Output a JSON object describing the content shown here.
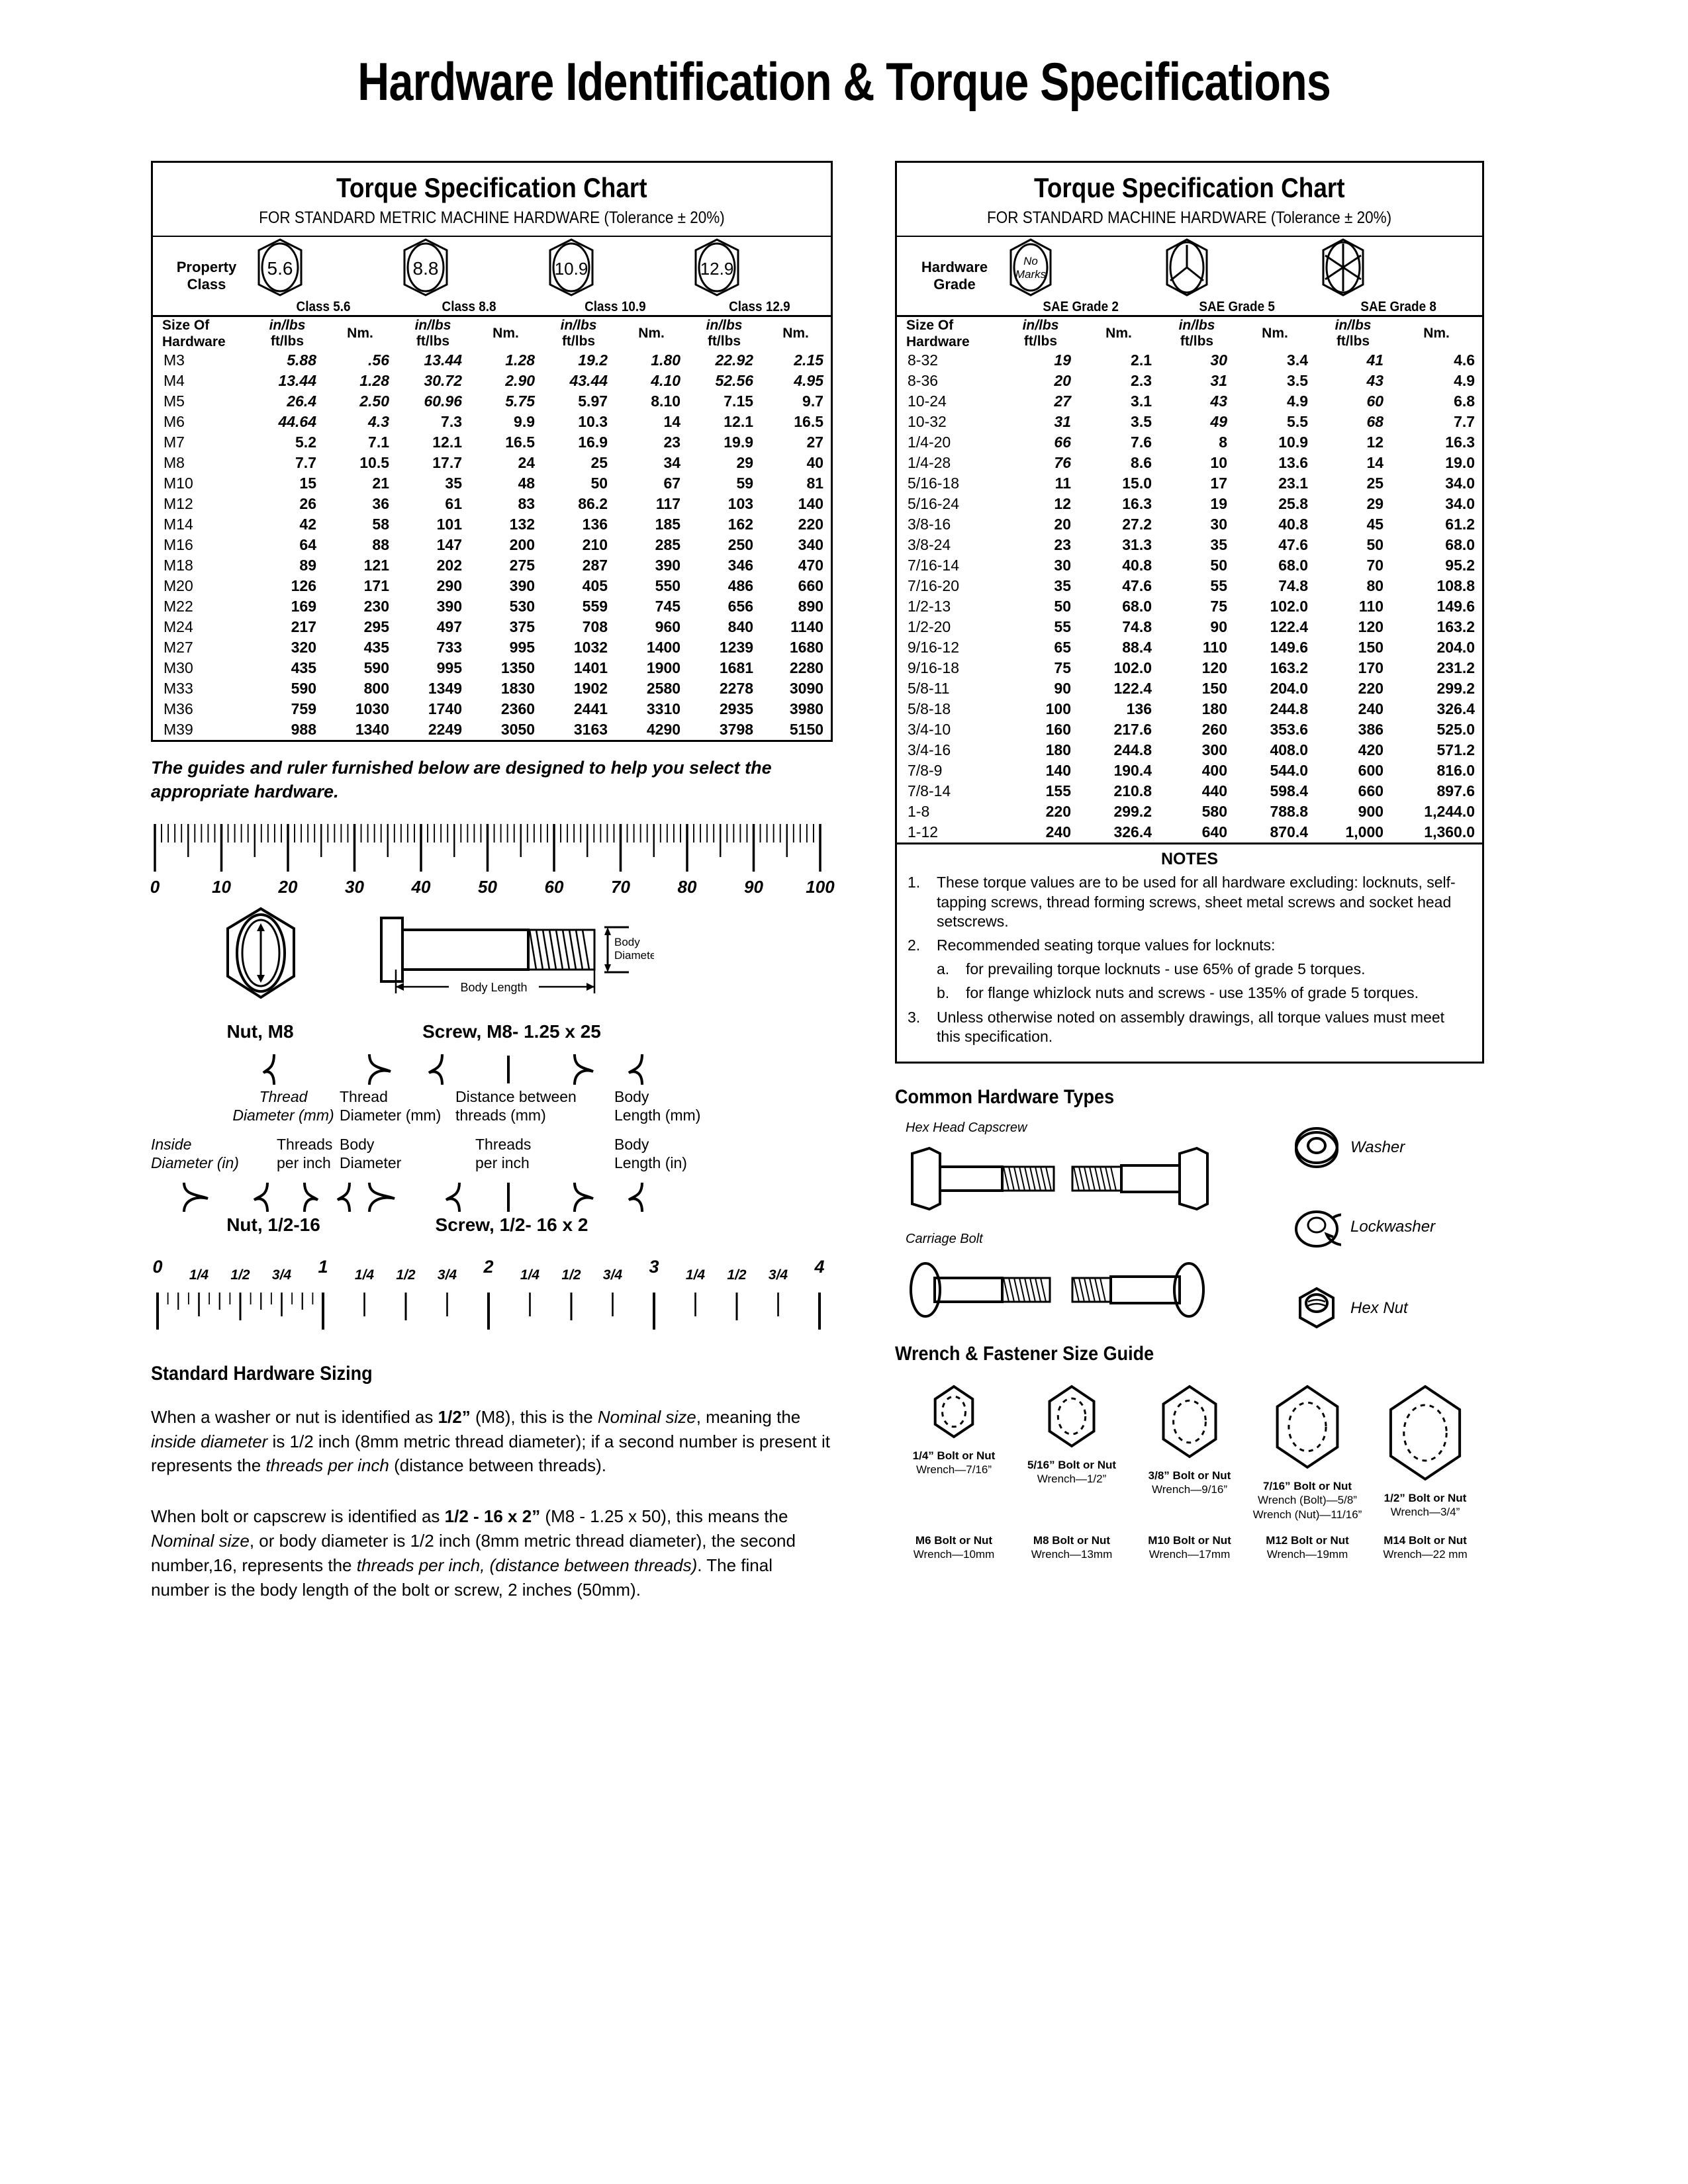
{
  "title": "Hardware Identification  &  Torque Specifications",
  "metric_table": {
    "heading": "Torque Specification Chart",
    "subheading": "FOR STANDARD METRIC MACHINE HARDWARE (Tolerance ± 20%)",
    "grade_row_label": "Property Class",
    "size_label_l1": "Size Of",
    "size_label_l2": "Hardware",
    "unit_in": "in/lbs",
    "unit_ft": "ft/lbs",
    "unit_nm": "Nm.",
    "grades": [
      {
        "mark": "5.6",
        "label": "Class 5.6"
      },
      {
        "mark": "8.8",
        "label": "Class 8.8"
      },
      {
        "mark": "10.9",
        "label": "Class 10.9"
      },
      {
        "mark": "12.9",
        "label": "Class 12.9"
      }
    ],
    "inlbs_last_row_index": {
      "c56": 3,
      "c88": 2,
      "c109": 1,
      "c129": 1
    },
    "rows": [
      {
        "size": "M3",
        "v": [
          "5.88",
          ".56",
          "13.44",
          "1.28",
          "19.2",
          "1.80",
          "22.92",
          "2.15"
        ]
      },
      {
        "size": "M4",
        "v": [
          "13.44",
          "1.28",
          "30.72",
          "2.90",
          "43.44",
          "4.10",
          "52.56",
          "4.95"
        ]
      },
      {
        "size": "M5",
        "v": [
          "26.4",
          "2.50",
          "60.96",
          "5.75",
          "5.97",
          "8.10",
          "7.15",
          "9.7"
        ]
      },
      {
        "size": "M6",
        "v": [
          "44.64",
          "4.3",
          "7.3",
          "9.9",
          "10.3",
          "14",
          "12.1",
          "16.5"
        ]
      },
      {
        "size": "M7",
        "v": [
          "5.2",
          "7.1",
          "12.1",
          "16.5",
          "16.9",
          "23",
          "19.9",
          "27"
        ]
      },
      {
        "size": "M8",
        "v": [
          "7.7",
          "10.5",
          "17.7",
          "24",
          "25",
          "34",
          "29",
          "40"
        ]
      },
      {
        "size": "M10",
        "v": [
          "15",
          "21",
          "35",
          "48",
          "50",
          "67",
          "59",
          "81"
        ]
      },
      {
        "size": "M12",
        "v": [
          "26",
          "36",
          "61",
          "83",
          "86.2",
          "117",
          "103",
          "140"
        ]
      },
      {
        "size": "M14",
        "v": [
          "42",
          "58",
          "101",
          "132",
          "136",
          "185",
          "162",
          "220"
        ]
      },
      {
        "size": "M16",
        "v": [
          "64",
          "88",
          "147",
          "200",
          "210",
          "285",
          "250",
          "340"
        ]
      },
      {
        "size": "M18",
        "v": [
          "89",
          "121",
          "202",
          "275",
          "287",
          "390",
          "346",
          "470"
        ]
      },
      {
        "size": "M20",
        "v": [
          "126",
          "171",
          "290",
          "390",
          "405",
          "550",
          "486",
          "660"
        ]
      },
      {
        "size": "M22",
        "v": [
          "169",
          "230",
          "390",
          "530",
          "559",
          "745",
          "656",
          "890"
        ]
      },
      {
        "size": "M24",
        "v": [
          "217",
          "295",
          "497",
          "375",
          "708",
          "960",
          "840",
          "1140"
        ]
      },
      {
        "size": "M27",
        "v": [
          "320",
          "435",
          "733",
          "995",
          "1032",
          "1400",
          "1239",
          "1680"
        ]
      },
      {
        "size": "M30",
        "v": [
          "435",
          "590",
          "995",
          "1350",
          "1401",
          "1900",
          "1681",
          "2280"
        ]
      },
      {
        "size": "M33",
        "v": [
          "590",
          "800",
          "1349",
          "1830",
          "1902",
          "2580",
          "2278",
          "3090"
        ]
      },
      {
        "size": "M36",
        "v": [
          "759",
          "1030",
          "1740",
          "2360",
          "2441",
          "3310",
          "2935",
          "3980"
        ]
      },
      {
        "size": "M39",
        "v": [
          "988",
          "1340",
          "2249",
          "3050",
          "3163",
          "4290",
          "3798",
          "5150"
        ]
      }
    ]
  },
  "sae_table": {
    "heading": "Torque Specification Chart",
    "subheading": "FOR STANDARD MACHINE HARDWARE (Tolerance ± 20%)",
    "grade_row_label": "Hardware Grade",
    "size_label_l1": "Size Of",
    "size_label_l2": "Hardware",
    "unit_in": "in/lbs",
    "unit_ft": "ft/lbs",
    "unit_nm": "Nm.",
    "grades": [
      {
        "mark": "No Marks",
        "label": "SAE Grade 2",
        "marks": 0
      },
      {
        "mark": "",
        "label": "SAE Grade 5",
        "marks": 3
      },
      {
        "mark": "",
        "label": "SAE Grade 8",
        "marks": 6
      }
    ],
    "inlbs_last_row_index": {
      "g2": 5,
      "g5": 3,
      "g8": 3
    },
    "rows": [
      {
        "size": "8-32",
        "v": [
          "19",
          "2.1",
          "30",
          "3.4",
          "41",
          "4.6"
        ]
      },
      {
        "size": "8-36",
        "v": [
          "20",
          "2.3",
          "31",
          "3.5",
          "43",
          "4.9"
        ]
      },
      {
        "size": "10-24",
        "v": [
          "27",
          "3.1",
          "43",
          "4.9",
          "60",
          "6.8"
        ]
      },
      {
        "size": "10-32",
        "v": [
          "31",
          "3.5",
          "49",
          "5.5",
          "68",
          "7.7"
        ]
      },
      {
        "size": "1/4-20",
        "v": [
          "66",
          "7.6",
          "8",
          "10.9",
          "12",
          "16.3"
        ]
      },
      {
        "size": "1/4-28",
        "v": [
          "76",
          "8.6",
          "10",
          "13.6",
          "14",
          "19.0"
        ]
      },
      {
        "size": "5/16-18",
        "v": [
          "11",
          "15.0",
          "17",
          "23.1",
          "25",
          "34.0"
        ]
      },
      {
        "size": "5/16-24",
        "v": [
          "12",
          "16.3",
          "19",
          "25.8",
          "29",
          "34.0"
        ]
      },
      {
        "size": "3/8-16",
        "v": [
          "20",
          "27.2",
          "30",
          "40.8",
          "45",
          "61.2"
        ]
      },
      {
        "size": "3/8-24",
        "v": [
          "23",
          "31.3",
          "35",
          "47.6",
          "50",
          "68.0"
        ]
      },
      {
        "size": "7/16-14",
        "v": [
          "30",
          "40.8",
          "50",
          "68.0",
          "70",
          "95.2"
        ]
      },
      {
        "size": "7/16-20",
        "v": [
          "35",
          "47.6",
          "55",
          "74.8",
          "80",
          "108.8"
        ]
      },
      {
        "size": "1/2-13",
        "v": [
          "50",
          "68.0",
          "75",
          "102.0",
          "110",
          "149.6"
        ]
      },
      {
        "size": "1/2-20",
        "v": [
          "55",
          "74.8",
          "90",
          "122.4",
          "120",
          "163.2"
        ]
      },
      {
        "size": "9/16-12",
        "v": [
          "65",
          "88.4",
          "110",
          "149.6",
          "150",
          "204.0"
        ]
      },
      {
        "size": "9/16-18",
        "v": [
          "75",
          "102.0",
          "120",
          "163.2",
          "170",
          "231.2"
        ]
      },
      {
        "size": "5/8-11",
        "v": [
          "90",
          "122.4",
          "150",
          "204.0",
          "220",
          "299.2"
        ]
      },
      {
        "size": "5/8-18",
        "v": [
          "100",
          "136",
          "180",
          "244.8",
          "240",
          "326.4"
        ]
      },
      {
        "size": "3/4-10",
        "v": [
          "160",
          "217.6",
          "260",
          "353.6",
          "386",
          "525.0"
        ]
      },
      {
        "size": "3/4-16",
        "v": [
          "180",
          "244.8",
          "300",
          "408.0",
          "420",
          "571.2"
        ]
      },
      {
        "size": "7/8-9",
        "v": [
          "140",
          "190.4",
          "400",
          "544.0",
          "600",
          "816.0"
        ]
      },
      {
        "size": "7/8-14",
        "v": [
          "155",
          "210.8",
          "440",
          "598.4",
          "660",
          "897.6"
        ]
      },
      {
        "size": "1-8",
        "v": [
          "220",
          "299.2",
          "580",
          "788.8",
          "900",
          "1,244.0"
        ]
      },
      {
        "size": "1-12",
        "v": [
          "240",
          "326.4",
          "640",
          "870.4",
          "1,000",
          "1,360.0"
        ]
      }
    ]
  },
  "notes": {
    "title": "NOTES",
    "items": [
      {
        "num": "1.",
        "text": "These torque values are to be used for all hardware excluding: locknuts, self-tapping screws, thread forming screws, sheet metal screws and socket head setscrews."
      },
      {
        "num": "2.",
        "text": "Recommended seating torque values for locknuts:"
      },
      {
        "num": "a.",
        "sub": true,
        "text": "for prevailing torque locknuts - use 65% of grade 5 torques."
      },
      {
        "num": "b.",
        "sub": true,
        "text": "for flange whizlock nuts and screws - use 135% of grade 5 torques."
      },
      {
        "num": "3.",
        "text": "Unless otherwise noted on assembly drawings, all torque values must meet this specification."
      }
    ]
  },
  "guides_intro": "The guides and ruler furnished below are designed to help you select the appropriate hardware.",
  "mm_ruler": {
    "labels": [
      "0",
      "10",
      "20",
      "30",
      "40",
      "50",
      "60",
      "70",
      "80",
      "90",
      "100"
    ]
  },
  "inch_ruler": {
    "whole": [
      "0",
      "1",
      "2",
      "3",
      "4"
    ],
    "fractions": [
      "1/4",
      "1/2",
      "3/4"
    ]
  },
  "metric_example": {
    "nut_caption": "Nut, M8",
    "screw_caption": "Screw, M8- 1.25 x 25",
    "body_diameter_label": "Body\nDiameter",
    "body_length_label": "Body Length",
    "nut_note": "Thread\nDiameter (mm)",
    "screw_notes": [
      "Thread\nDiameter (mm)",
      "Distance between\nthreads (mm)",
      "Body\nLength (mm)"
    ]
  },
  "inch_example": {
    "nut_caption": "Nut, 1/2-16",
    "screw_caption": "Screw, 1/2- 16 x 2",
    "nut_notes": [
      "Inside\nDiameter (in)",
      "Threads\nper inch"
    ],
    "screw_notes": [
      "Body\nDiameter",
      "Threads\nper inch",
      "Body\nLength (in)"
    ]
  },
  "sizing_section": {
    "heading": "Standard Hardware Sizing",
    "p1_parts": [
      {
        "t": "When a washer or nut is identified as "
      },
      {
        "t": "1/2”",
        "b": true
      },
      {
        "t": " (M8), this is the "
      },
      {
        "t": "Nominal size",
        "i": true
      },
      {
        "t": ", meaning the "
      },
      {
        "t": "inside diameter",
        "i": true
      },
      {
        "t": " is 1/2 inch (8mm metric thread diameter); if a second number is present it represents the "
      },
      {
        "t": "threads per inch",
        "i": true
      },
      {
        "t": " (distance between threads)."
      }
    ],
    "p2_parts": [
      {
        "t": "When bolt or capscrew is identified as "
      },
      {
        "t": "1/2 - 16 x 2”",
        "b": true
      },
      {
        "t": " (M8 - 1.25 x 50), this means the "
      },
      {
        "t": "Nominal size",
        "i": true
      },
      {
        "t": ", or body diameter is 1/2 inch (8mm metric thread diameter), the second number,16, represents the "
      },
      {
        "t": "threads per inch, (distance between threads)",
        "i": true
      },
      {
        "t": ".  The final number is the body length of the bolt or screw, 2 inches (50mm)."
      }
    ]
  },
  "common_hardware": {
    "heading": "Common Hardware Types",
    "items": [
      {
        "label": "Hex Head Capscrew",
        "icon": "hex-head-capscrew-icon"
      },
      {
        "label": "Carriage Bolt",
        "icon": "carriage-bolt-icon"
      }
    ],
    "side_items": [
      {
        "label": "Washer",
        "icon": "washer-icon"
      },
      {
        "label": "Lockwasher",
        "icon": "lockwasher-icon"
      },
      {
        "label": "Hex Nut",
        "icon": "hex-nut-icon"
      }
    ]
  },
  "wrench_guide": {
    "heading": "Wrench & Fastener Size Guide",
    "imperial": [
      {
        "size": "1/4” Bolt or Nut",
        "wrench": "Wrench—7/16”",
        "hex": 38
      },
      {
        "size": "5/16” Bolt or Nut",
        "wrench": "Wrench—1/2”",
        "hex": 45
      },
      {
        "size": "3/8” Bolt or Nut",
        "wrench": "Wrench—9/16”",
        "hex": 53
      },
      {
        "size": "7/16” Bolt or Nut",
        "wrench": "Wrench (Bolt)—5/8”",
        "wrench2": "Wrench (Nut)—11/16”",
        "hex": 61
      },
      {
        "size": "1/2” Bolt or Nut",
        "wrench": "Wrench—3/4”",
        "hex": 70
      }
    ],
    "metric": [
      {
        "size": "M6 Bolt or Nut",
        "wrench": "Wrench—10mm"
      },
      {
        "size": "M8 Bolt or Nut",
        "wrench": "Wrench—13mm"
      },
      {
        "size": "M10 Bolt or Nut",
        "wrench": "Wrench—17mm"
      },
      {
        "size": "M12 Bolt or Nut",
        "wrench": "Wrench—19mm"
      },
      {
        "size": "M14 Bolt or Nut",
        "wrench": "Wrench—22 mm"
      }
    ]
  }
}
